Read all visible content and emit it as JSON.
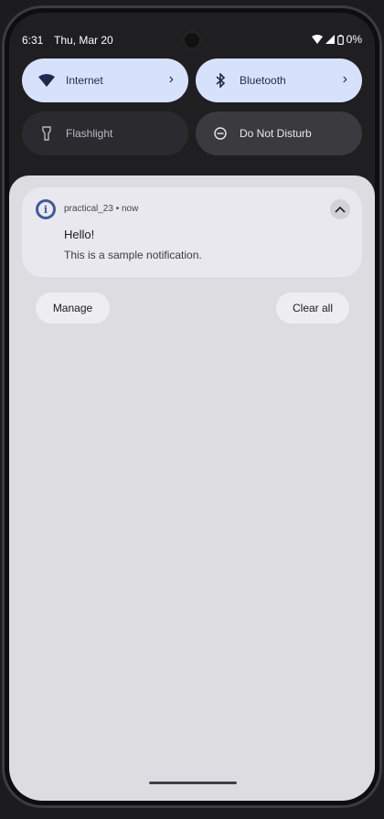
{
  "status_bar": {
    "time": "6:31",
    "date": "Thu, Mar 20",
    "battery": "0%"
  },
  "quick_settings": {
    "internet": "Internet",
    "bluetooth": "Bluetooth",
    "flashlight": "Flashlight",
    "dnd": "Do Not Disturb"
  },
  "notification": {
    "app": "practical_23",
    "time": "now",
    "title": "Hello!",
    "text": "This is a sample notification."
  },
  "actions": {
    "manage": "Manage",
    "clear_all": "Clear all"
  },
  "colors": {
    "tile_on": "#d7e1fc",
    "panel": "#dddce1",
    "app_icon": "#415a9b"
  }
}
